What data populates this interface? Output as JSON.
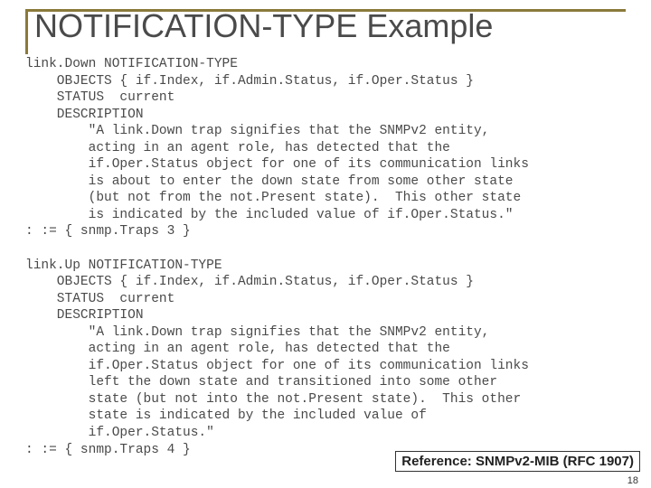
{
  "title": "NOTIFICATION-TYPE Example",
  "code": "link.Down NOTIFICATION-TYPE\n    OBJECTS { if.Index, if.Admin.Status, if.Oper.Status }\n    STATUS  current\n    DESCRIPTION\n        \"A link.Down trap signifies that the SNMPv2 entity,\n        acting in an agent role, has detected that the\n        if.Oper.Status object for one of its communication links\n        is about to enter the down state from some other state\n        (but not from the not.Present state).  This other state\n        is indicated by the included value of if.Oper.Status.\"\n: := { snmp.Traps 3 }\n\nlink.Up NOTIFICATION-TYPE\n    OBJECTS { if.Index, if.Admin.Status, if.Oper.Status }\n    STATUS  current\n    DESCRIPTION\n        \"A link.Down trap signifies that the SNMPv2 entity,\n        acting in an agent role, has detected that the\n        if.Oper.Status object for one of its communication links\n        left the down state and transitioned into some other\n        state (but not into the not.Present state).  This other\n        state is indicated by the included value of\n        if.Oper.Status.\"\n: := { snmp.Traps 4 }",
  "reference": "Reference: SNMPv2-MIB (RFC 1907)",
  "page_number": "18"
}
